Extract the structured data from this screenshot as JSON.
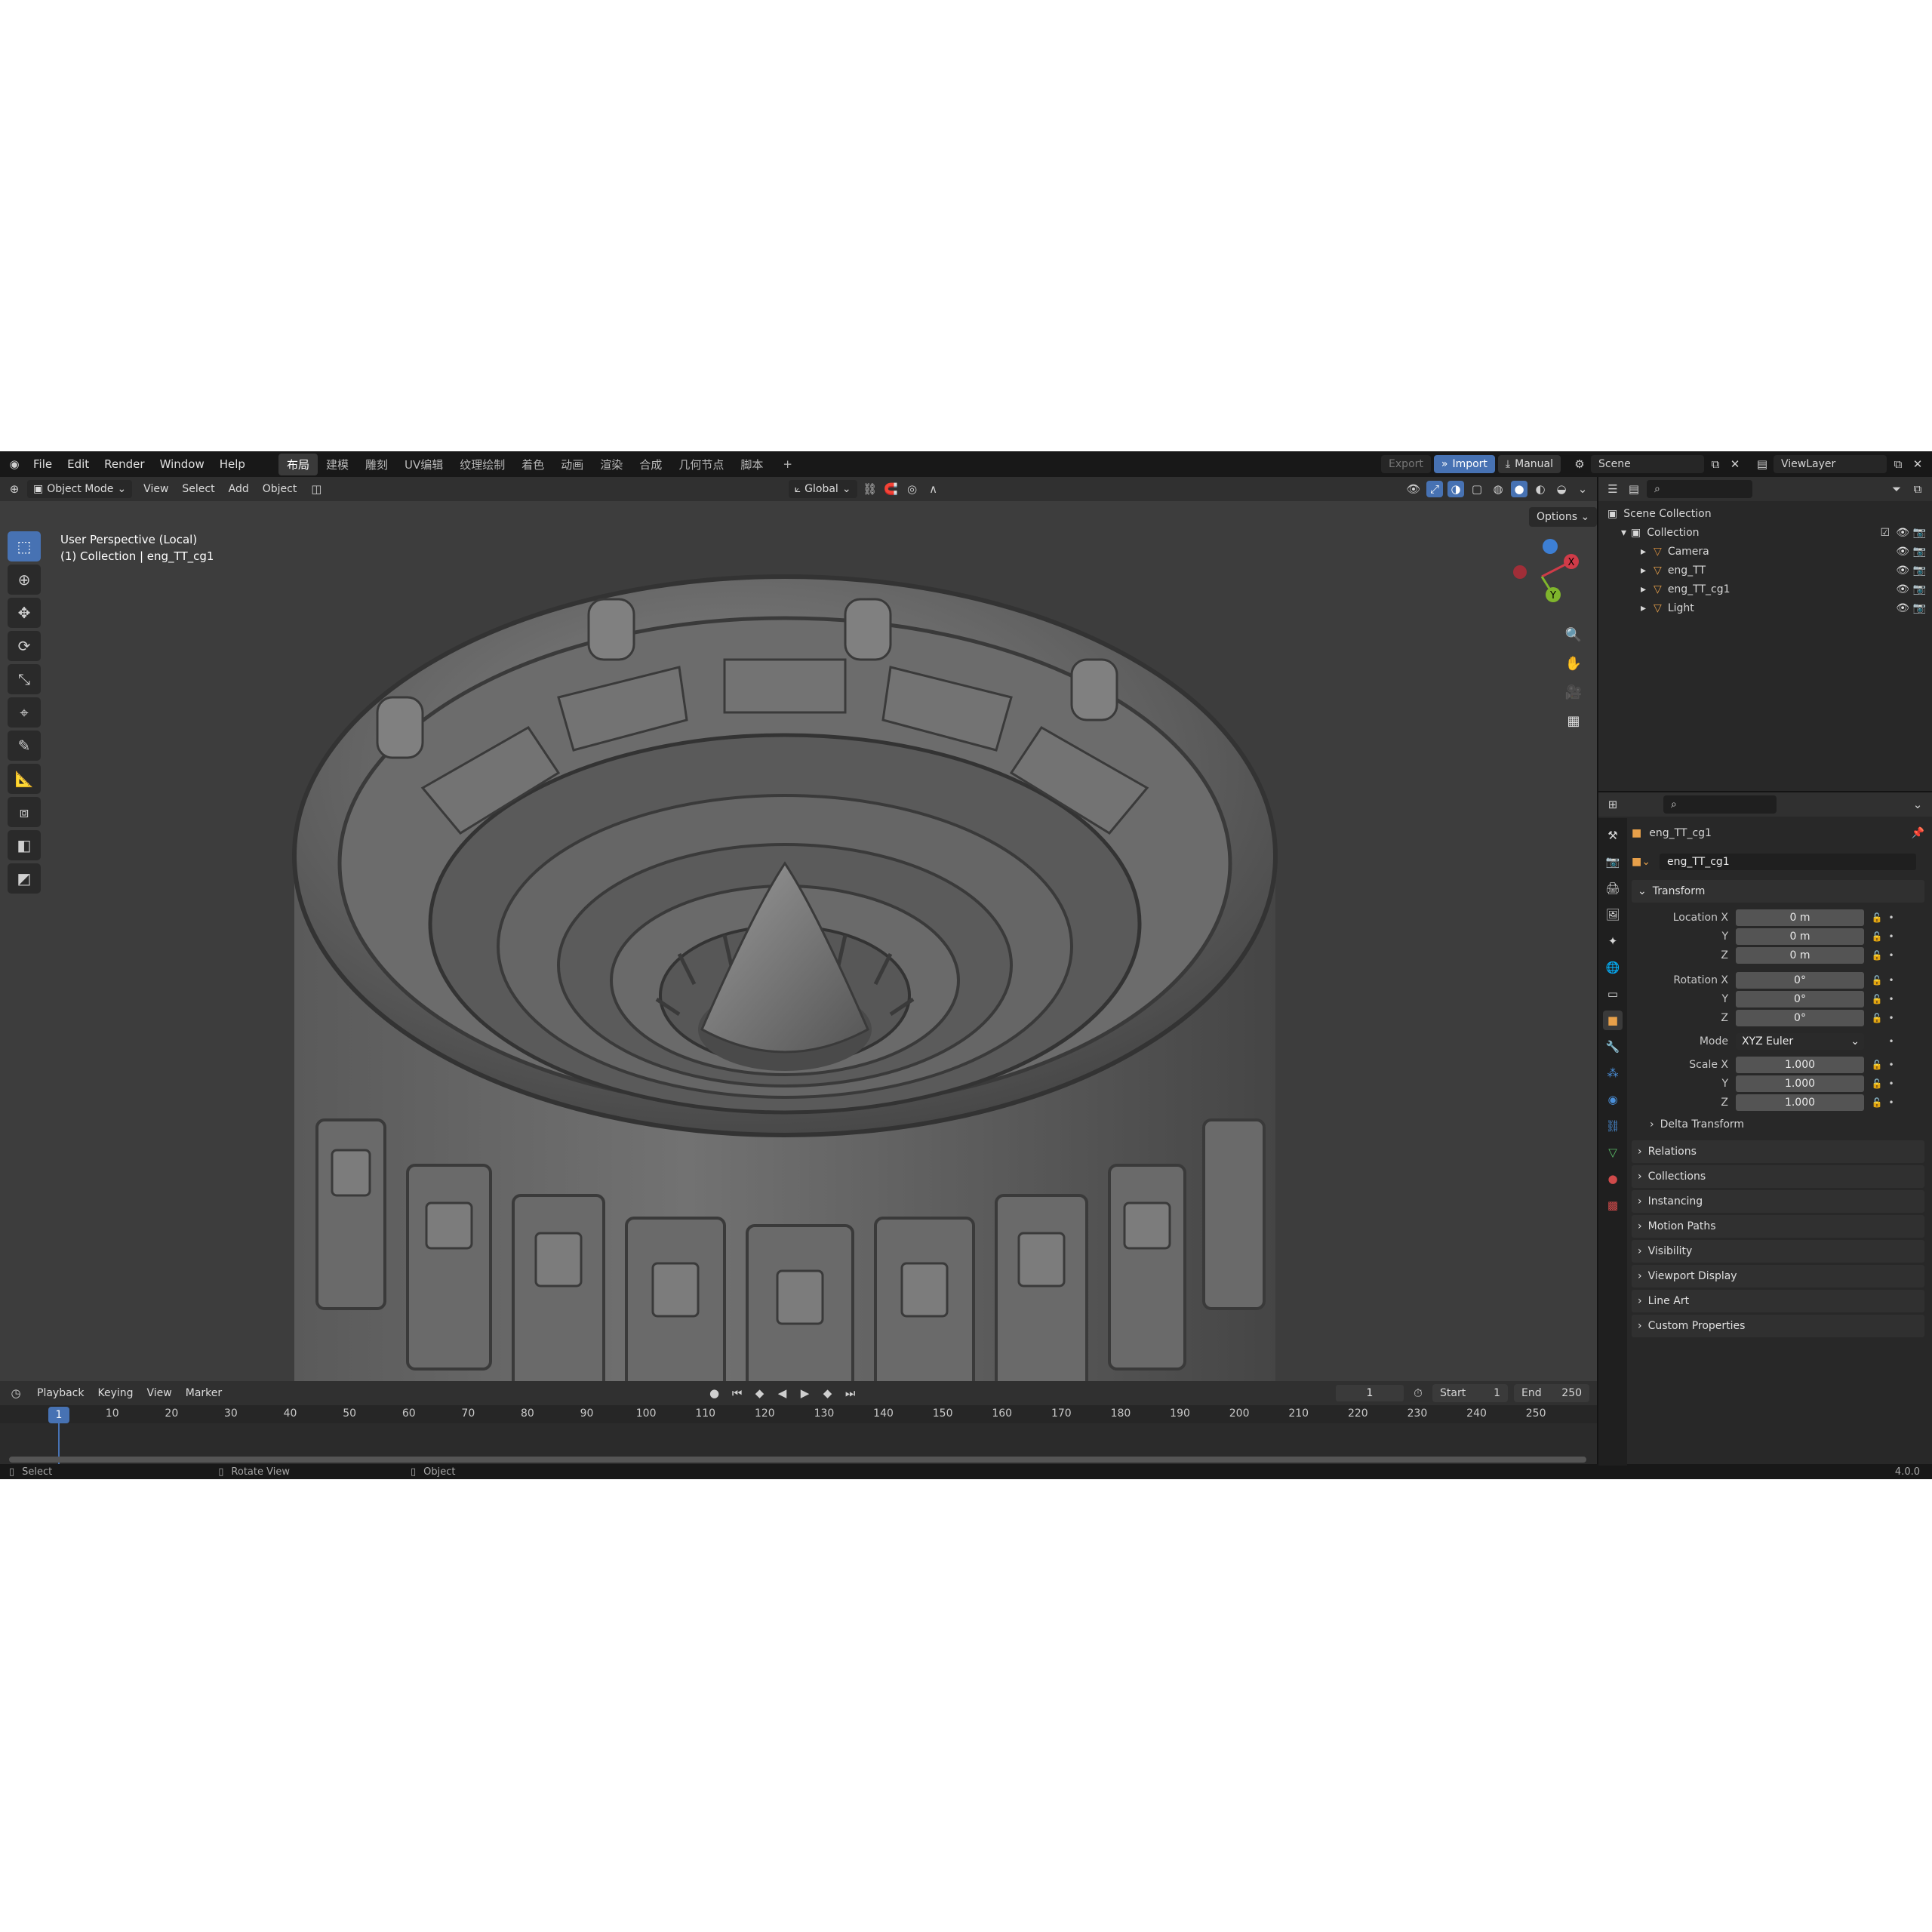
{
  "topbar": {
    "menus": [
      "File",
      "Edit",
      "Render",
      "Window",
      "Help"
    ],
    "workspaces": [
      "布局",
      "建模",
      "雕刻",
      "UV编辑",
      "纹理绘制",
      "着色",
      "动画",
      "渲染",
      "合成",
      "几何节点",
      "脚本"
    ],
    "active_workspace_index": 0,
    "add_tab": "+",
    "export_label": "Export",
    "import_label": "Import",
    "manual_label": "Manual",
    "scene_name": "Scene",
    "view_layer": "ViewLayer"
  },
  "viewport_header": {
    "mode": "Object Mode",
    "menus": [
      "View",
      "Select",
      "Add",
      "Object"
    ],
    "transform_orientation": "Global",
    "options_label": "Options"
  },
  "viewport": {
    "perspective_label": "User Perspective (Local)",
    "collection_label": "(1) Collection | eng_TT_cg1",
    "gizmo": {
      "x": "X",
      "y": "Y"
    }
  },
  "timeline": {
    "menus": [
      "Playback",
      "Keying",
      "View",
      "Marker"
    ],
    "current_frame": "1",
    "start_label": "Start",
    "start_value": "1",
    "end_label": "End",
    "end_value": "250",
    "ruler_ticks": [
      "10",
      "20",
      "30",
      "40",
      "50",
      "60",
      "70",
      "80",
      "90",
      "100",
      "110",
      "120",
      "130",
      "140",
      "150",
      "160",
      "170",
      "180",
      "190",
      "200",
      "210",
      "220",
      "230",
      "240",
      "250"
    ],
    "playhead": "1"
  },
  "statusbar": {
    "select": "Select",
    "rotate": "Rotate View",
    "object": "Object",
    "version": "4.0.0"
  },
  "outliner": {
    "scene_collection": "Scene Collection",
    "collection": "Collection",
    "items": [
      {
        "name": "Camera",
        "color": "#d28b3e"
      },
      {
        "name": "eng_TT",
        "color": "#e7a04a"
      },
      {
        "name": "eng_TT_cg1",
        "color": "#e7a04a"
      },
      {
        "name": "Light",
        "color": "#e7a04a"
      }
    ]
  },
  "properties": {
    "object_name": "eng_TT_cg1",
    "datablock_name": "eng_TT_cg1",
    "transform_title": "Transform",
    "location": {
      "label": "Location X",
      "x": "0 m",
      "y": "0 m",
      "z": "0 m"
    },
    "rotation": {
      "label": "Rotation X",
      "x": "0°",
      "y": "0°",
      "z": "0°"
    },
    "mode_label": "Mode",
    "mode_value": "XYZ Euler",
    "scale": {
      "label": "Scale X",
      "x": "1.000",
      "y": "1.000",
      "z": "1.000"
    },
    "axis_y": "Y",
    "axis_z": "Z",
    "delta_transform": "Delta Transform",
    "panels": [
      "Relations",
      "Collections",
      "Instancing",
      "Motion Paths",
      "Visibility",
      "Viewport Display",
      "Line Art",
      "Custom Properties"
    ]
  },
  "colors": {
    "accent": "#4772b3",
    "axis_x": "#d03b48",
    "axis_y": "#7fb52c",
    "axis_z": "#3d7fd4"
  }
}
